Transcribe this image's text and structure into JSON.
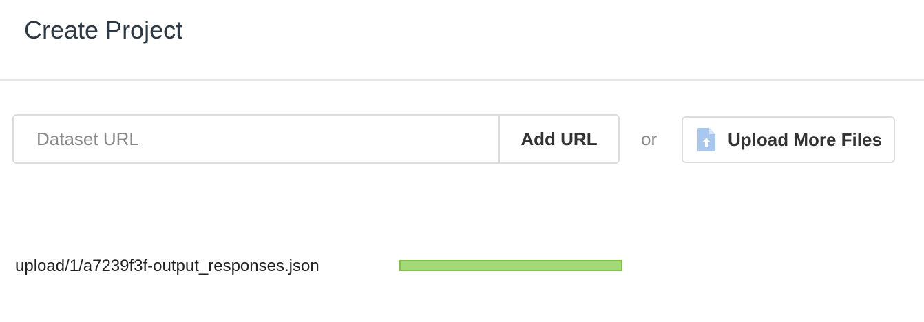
{
  "header": {
    "title": "Create Project"
  },
  "dataset_url": {
    "placeholder": "Dataset URL",
    "value": "",
    "add_button_label": "Add URL"
  },
  "separator_text": "or",
  "upload": {
    "label": "Upload More Files",
    "icon": "file-upload-icon",
    "icon_color": "#a8c8f0"
  },
  "files": [
    {
      "name": "upload/1/a7239f3f-output_responses.json",
      "progress": 1.0,
      "progress_color": "#a3d977"
    }
  ]
}
